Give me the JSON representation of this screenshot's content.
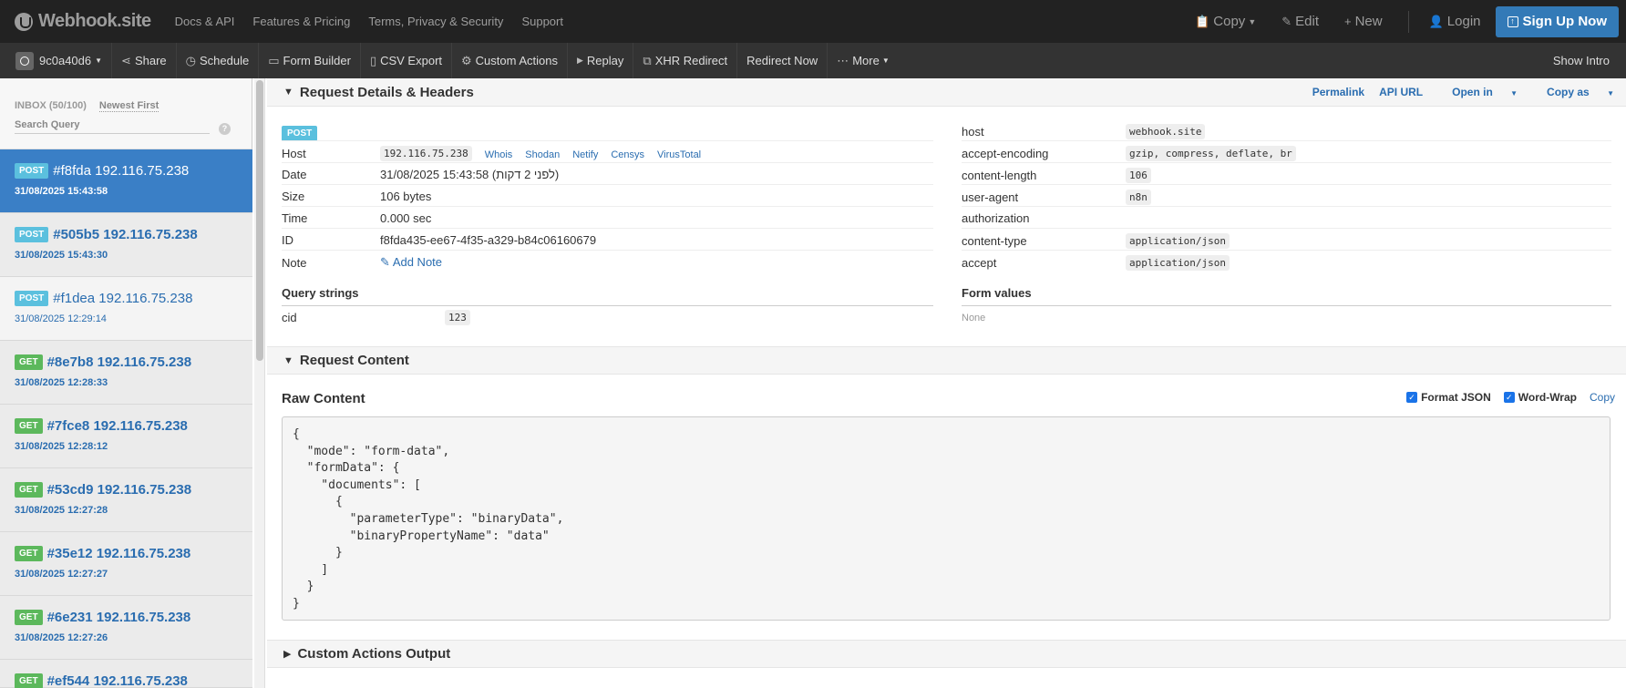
{
  "brand": {
    "name": "Webhook.site"
  },
  "topnav": {
    "items": [
      "Docs & API",
      "Features & Pricing",
      "Terms, Privacy & Security",
      "Support"
    ]
  },
  "topright": {
    "copy": "Copy",
    "edit": "Edit",
    "new": "New",
    "login": "Login",
    "signup": "Sign Up Now"
  },
  "toolbar": {
    "token": "9c0a40d6",
    "items": [
      "Share",
      "Schedule",
      "Form Builder",
      "CSV Export",
      "Custom Actions",
      "Replay",
      "XHR Redirect",
      "Redirect Now",
      "More"
    ],
    "show_intro": "Show Intro"
  },
  "sidebar": {
    "inbox": "INBOX (50/100)",
    "sort": "Newest First",
    "search_placeholder": "Search Query",
    "help": "?",
    "requests": [
      {
        "method": "POST",
        "id": "#f8fda",
        "ip": "192.116.75.238",
        "time": "31/08/2025 15:43:58"
      },
      {
        "method": "POST",
        "id": "#505b5",
        "ip": "192.116.75.238",
        "time": "31/08/2025 15:43:30"
      },
      {
        "method": "POST",
        "id": "#f1dea",
        "ip": "192.116.75.238",
        "time": "31/08/2025 12:29:14"
      },
      {
        "method": "GET",
        "id": "#8e7b8",
        "ip": "192.116.75.238",
        "time": "31/08/2025 12:28:33"
      },
      {
        "method": "GET",
        "id": "#7fce8",
        "ip": "192.116.75.238",
        "time": "31/08/2025 12:28:12"
      },
      {
        "method": "GET",
        "id": "#53cd9",
        "ip": "192.116.75.238",
        "time": "31/08/2025 12:27:28"
      },
      {
        "method": "GET",
        "id": "#35e12",
        "ip": "192.116.75.238",
        "time": "31/08/2025 12:27:27"
      },
      {
        "method": "GET",
        "id": "#6e231",
        "ip": "192.116.75.238",
        "time": "31/08/2025 12:27:26"
      },
      {
        "method": "GET",
        "id": "#ef544",
        "ip": "192.116.75.238",
        "time": ""
      }
    ]
  },
  "details": {
    "title": "Request Details & Headers",
    "links": [
      "Permalink",
      "API URL",
      "Open in",
      "Copy as"
    ],
    "method": "POST",
    "host_label": "Host",
    "host": "192.116.75.238",
    "host_links": [
      "Whois",
      "Shodan",
      "Netify",
      "Censys",
      "VirusTotal"
    ],
    "date_label": "Date",
    "date": "31/08/2025 15:43:58 (לפני 2 דקות)",
    "size_label": "Size",
    "size": "106 bytes",
    "time_label": "Time",
    "time": "0.000 sec",
    "id_label": "ID",
    "id": "f8fda435-ee67-4f35-a329-b84c06160679",
    "note_label": "Note",
    "note_action": "Add Note",
    "query_title": "Query strings",
    "query": [
      {
        "key": "cid",
        "value": "123"
      }
    ],
    "form_title": "Form values",
    "form_none": "None",
    "headers": [
      {
        "key": "host",
        "value": "webhook.site"
      },
      {
        "key": "accept-encoding",
        "value": "gzip, compress, deflate, br"
      },
      {
        "key": "content-length",
        "value": "106"
      },
      {
        "key": "user-agent",
        "value": "n8n"
      },
      {
        "key": "authorization",
        "value": ""
      },
      {
        "key": "content-type",
        "value": "application/json"
      },
      {
        "key": "accept",
        "value": "application/json"
      }
    ]
  },
  "content": {
    "title": "Request Content",
    "raw_title": "Raw Content",
    "format_json": "Format JSON",
    "word_wrap": "Word-Wrap",
    "copy": "Copy",
    "raw": "{\n  \"mode\": \"form-data\",\n  \"formData\": {\n    \"documents\": [\n      {\n        \"parameterType\": \"binaryData\",\n        \"binaryPropertyName\": \"data\"\n      }\n    ]\n  }\n}"
  },
  "custom_actions": {
    "title": "Custom Actions Output"
  }
}
